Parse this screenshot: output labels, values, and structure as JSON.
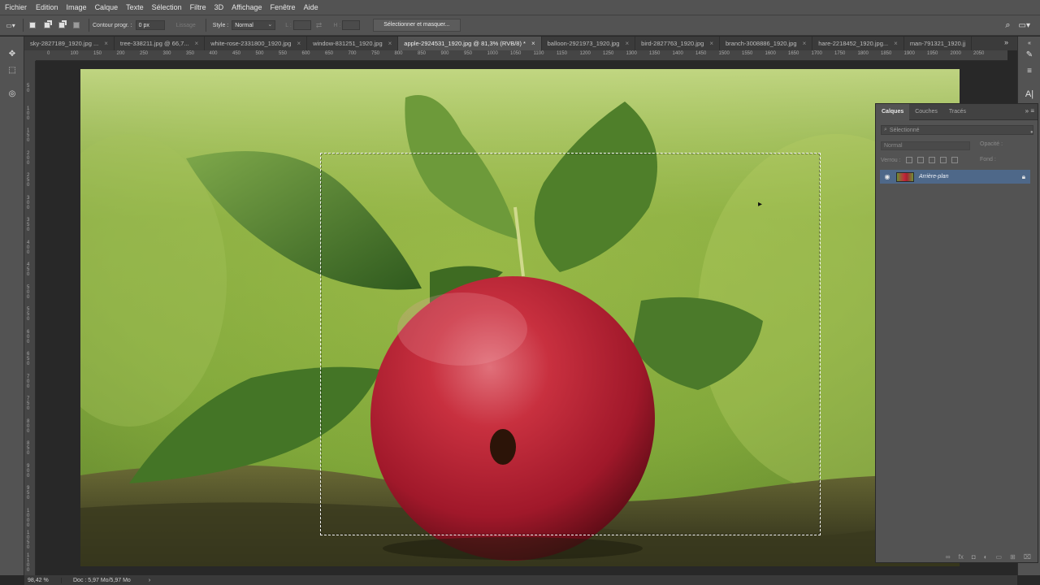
{
  "menu": [
    "Fichier",
    "Edition",
    "Image",
    "Calque",
    "Texte",
    "Sélection",
    "Filtre",
    "3D",
    "Affichage",
    "Fenêtre",
    "Aide"
  ],
  "options": {
    "feather_label": "Contour progr. :",
    "feather_value": "0 px",
    "antialias_label": "Lissage",
    "style_label": "Style :",
    "style_value": "Normal",
    "width_label": "L :",
    "height_label": "H :",
    "select_mask_button": "Sélectionner et masquer..."
  },
  "tabs": [
    "sky-2827189_1920.jpg ...",
    "tree-338211.jpg @ 66,7...",
    "white-rose-2331800_1920.jpg",
    "window-831251_1920.jpg",
    "apple-2924531_1920.jpg @ 81,3% (RVB/8) *",
    "balloon-2921973_1920.jpg",
    "bird-2827763_1920.jpg",
    "branch-3008886_1920.jpg",
    "hare-2218452_1920.jpg...",
    "man-791321_1920.jj"
  ],
  "tabs_more": "»",
  "ruler_top": [
    "0",
    "100",
    "150",
    "200",
    "250",
    "300",
    "350",
    "400",
    "450",
    "500",
    "550",
    "600",
    "650",
    "700",
    "750",
    "800",
    "850",
    "900",
    "950",
    "1000",
    "1050",
    "1100",
    "1150",
    "1200",
    "1250",
    "1300",
    "1350",
    "1400",
    "1450",
    "1500",
    "1550",
    "1600",
    "1650",
    "1700",
    "1750",
    "1800",
    "1850",
    "1900",
    "1950",
    "2000",
    "2050"
  ],
  "ruler_left": [
    "50",
    "100",
    "150",
    "200",
    "250",
    "300",
    "350",
    "400",
    "450",
    "500",
    "550",
    "600",
    "650",
    "700",
    "750",
    "800",
    "850",
    "900",
    "950",
    "1000",
    "1050",
    "1100",
    "1150"
  ],
  "status": {
    "zoom": "98,42 %",
    "doc": "Doc : 5,97 Mo/5,97 Mo",
    "arrow": "›"
  },
  "layers_panel": {
    "tabs": [
      "Calques",
      "Couches",
      "Tracés"
    ],
    "filter_placeholder": "Sélectionné",
    "blend_mode": "Normal",
    "opacity_label": "Opacité :",
    "lock_label": "Verrou :",
    "fill_label": "Fond :",
    "layer_name": "Arrière-plan"
  },
  "colors": {
    "selection_highlight": "#4e6889",
    "panel_bg": "#535353",
    "apple_red": "#c0283a"
  }
}
